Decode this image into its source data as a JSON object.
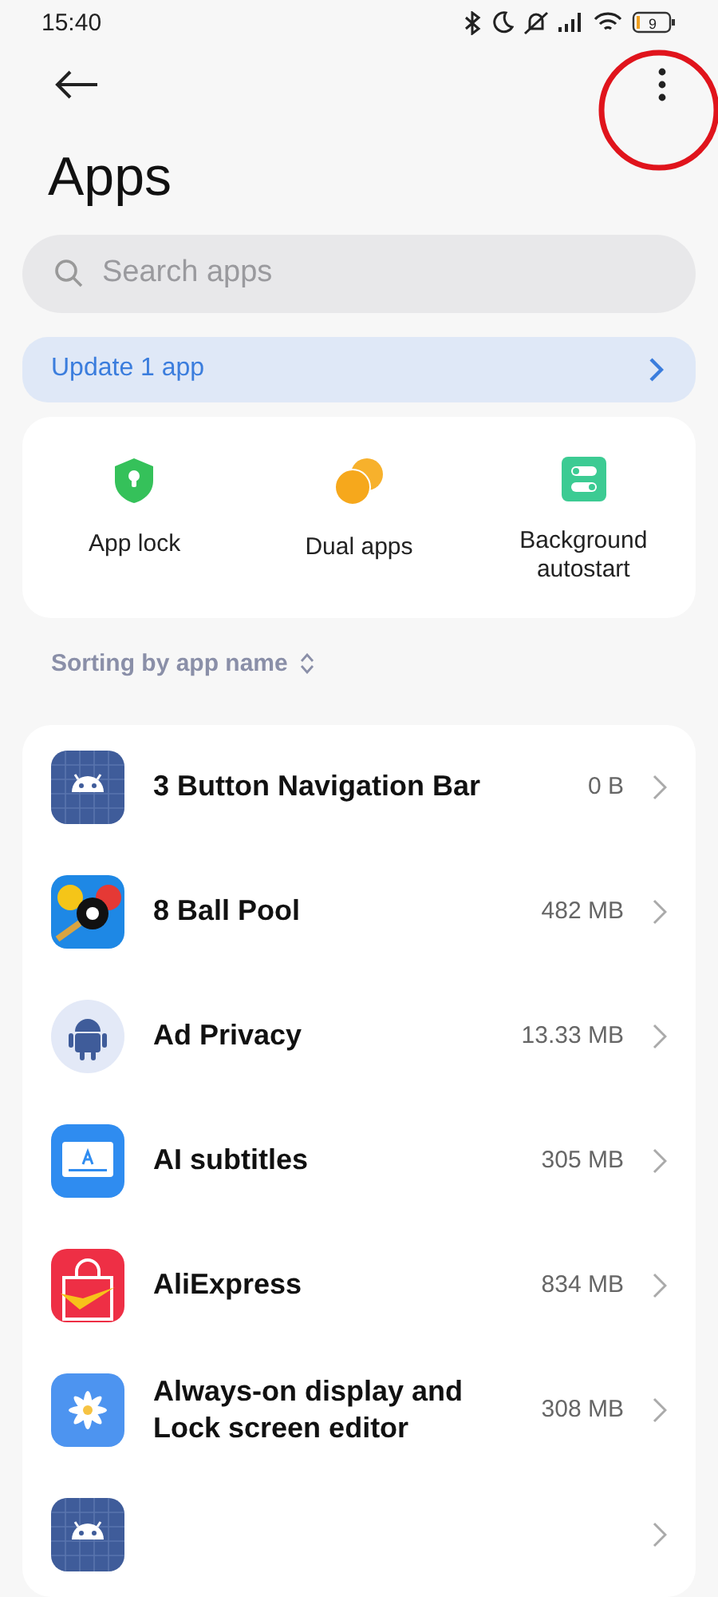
{
  "status_bar": {
    "time": "15:40",
    "battery": "9"
  },
  "header": {
    "menu_highlighted": true
  },
  "title": "Apps",
  "search": {
    "placeholder": "Search apps"
  },
  "update_banner": {
    "label": "Update 1 app"
  },
  "shortcuts": [
    {
      "kind": "lock",
      "label": "App lock"
    },
    {
      "kind": "dual",
      "label": "Dual apps"
    },
    {
      "kind": "toggles",
      "label": "Background autostart"
    }
  ],
  "sorting": {
    "label": "Sorting by app name"
  },
  "apps": [
    {
      "kind": "android-grid",
      "name": "3 Button Navigation Bar",
      "size": "0 B"
    },
    {
      "kind": "pool",
      "name": "8 Ball Pool",
      "size": "482 MB"
    },
    {
      "kind": "android-round",
      "name": "Ad Privacy",
      "size": "13.33 MB"
    },
    {
      "kind": "subtitles",
      "name": "AI subtitles",
      "size": "305 MB"
    },
    {
      "kind": "bag",
      "name": "AliExpress",
      "size": "834 MB"
    },
    {
      "kind": "flower",
      "name": "Always-on display and Lock screen editor",
      "size": "308 MB"
    },
    {
      "kind": "android-grid"
    }
  ]
}
